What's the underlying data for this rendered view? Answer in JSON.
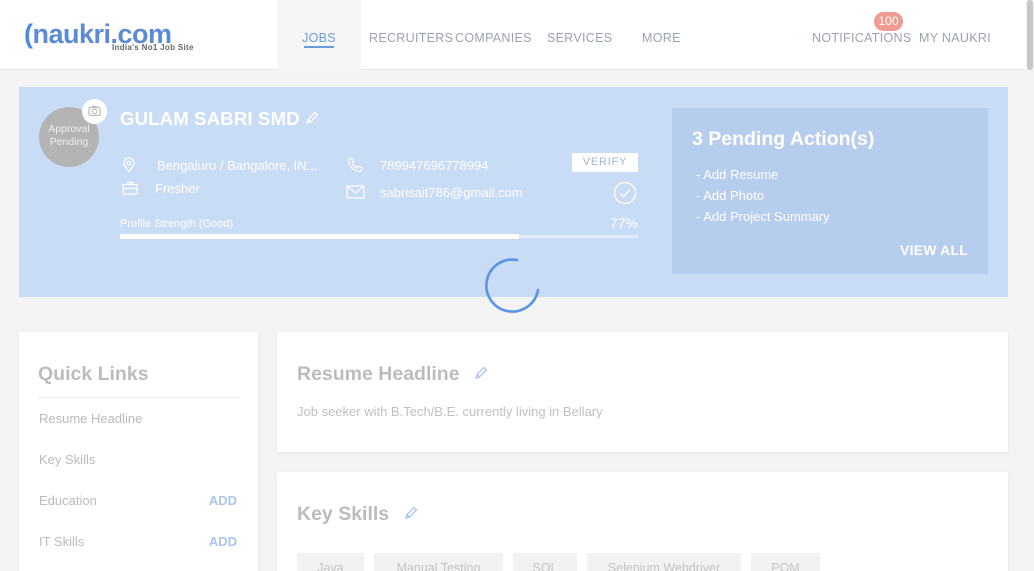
{
  "header": {
    "logo_main": "naukri.com",
    "logo_tagline": "India's No1 Job Site",
    "nav": [
      {
        "label": "JOBS"
      },
      {
        "label": "RECRUITERS"
      },
      {
        "label": "COMPANIES"
      },
      {
        "label": "SERVICES"
      },
      {
        "label": "MORE"
      },
      {
        "label": "NOTIFICATIONS"
      },
      {
        "label": "MY NAUKRI"
      }
    ],
    "notification_count": "100"
  },
  "profile": {
    "avatar_text": "Approval Pending",
    "name": "GULAM SABRI SMD",
    "location": "Bengaluru / Bangalore, IN...",
    "experience": "Fresher",
    "phone": "789947696778994",
    "email": "sabrisait786@gmail.com",
    "verify_label": "VERIFY",
    "strength_label": "Profile Strength (Good)",
    "strength_value": "77%",
    "strength_percent": 77
  },
  "pending": {
    "title": "3 Pending Action(s)",
    "items": [
      "- Add Resume",
      "- Add Photo",
      "- Add Project Summary"
    ],
    "view_all": "VIEW ALL"
  },
  "quick_links": {
    "title": "Quick Links",
    "items": [
      {
        "label": "Resume Headline",
        "action": ""
      },
      {
        "label": "Key Skills",
        "action": ""
      },
      {
        "label": "Education",
        "action": "ADD"
      },
      {
        "label": "IT Skills",
        "action": "ADD"
      }
    ]
  },
  "resume_headline": {
    "title": "Resume Headline",
    "text": "Job seeker with B.Tech/B.E. currently living in Bellary"
  },
  "key_skills": {
    "title": "Key Skills",
    "skills": [
      "Java",
      "Manual Testing",
      "SQL",
      "Selenium Webdriver",
      "POM"
    ]
  },
  "colors": {
    "accent": "#4a90e2",
    "profile_bg": "#c9dcf5",
    "badge": "#f19a92"
  }
}
